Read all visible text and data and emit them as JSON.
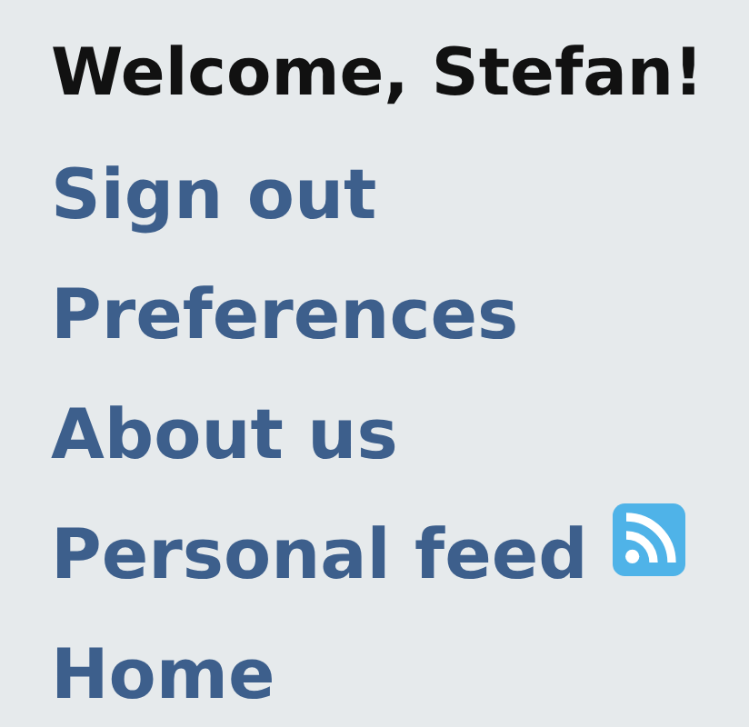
{
  "greeting": "Welcome, Stefan!",
  "links": [
    {
      "label": "Sign out",
      "feed_icon": false
    },
    {
      "label": "Preferences",
      "feed_icon": false
    },
    {
      "label": "About us",
      "feed_icon": false
    },
    {
      "label": "Personal feed",
      "feed_icon": true
    },
    {
      "label": "Home",
      "feed_icon": false
    }
  ]
}
